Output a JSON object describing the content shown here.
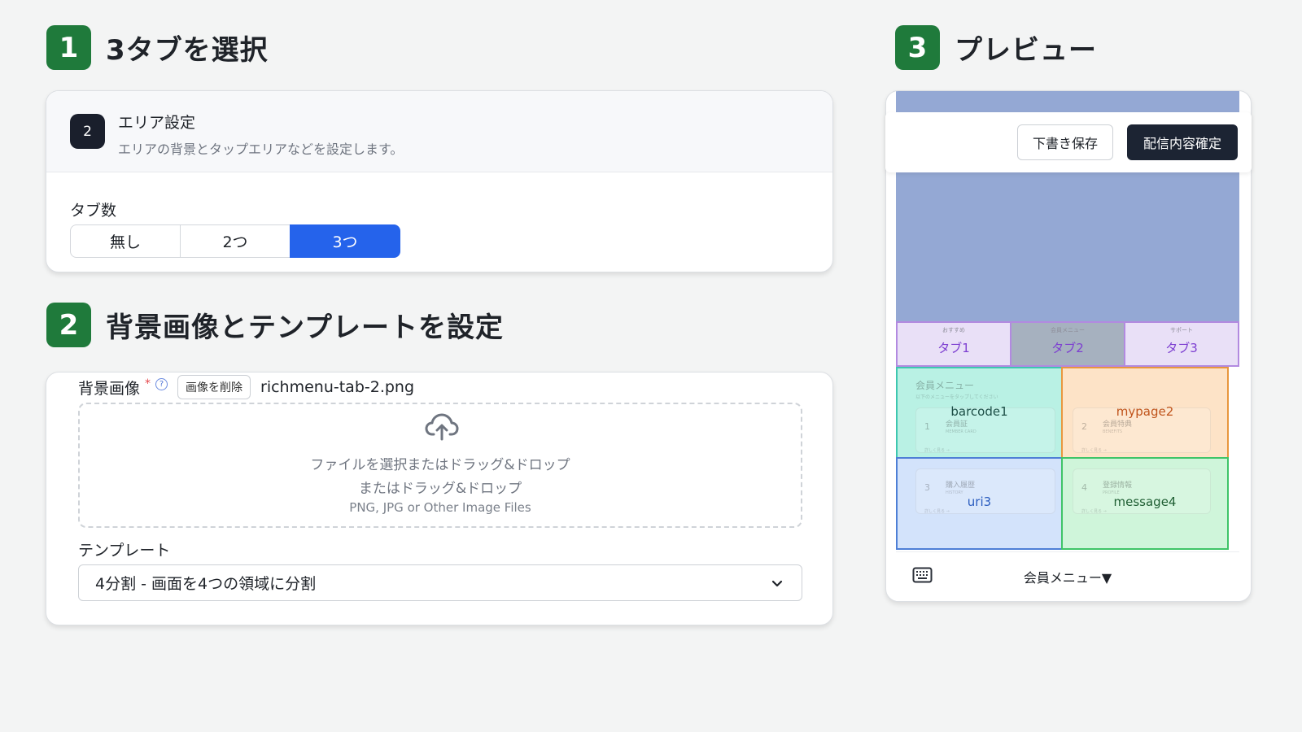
{
  "step1": {
    "number": "1",
    "title": "3タブを選択"
  },
  "step2": {
    "number": "2",
    "title": "背景画像とテンプレートを設定"
  },
  "step3": {
    "number": "3",
    "title": "プレビュー"
  },
  "area": {
    "badge": "2",
    "title": "エリア設定",
    "subtitle": "エリアの背景とタップエリアなどを設定します。",
    "tab_count_label": "タブ数",
    "options": [
      "無し",
      "2つ",
      "3つ"
    ],
    "selected": "3つ"
  },
  "background": {
    "label": "背景画像",
    "required_mark": "*",
    "help_icon": "?",
    "delete_button": "画像を削除",
    "file_name": "richmenu-tab-2.png",
    "drop_line1": "ファイルを選択またはドラッグ&ドロップ",
    "drop_line2": "またはドラッグ&ドロップ",
    "drop_line3": "PNG, JPG or Other Image Files"
  },
  "template": {
    "label": "テンプレート",
    "selected": "4分割 - 画面を4つの領域に分割"
  },
  "preview": {
    "draft_button": "下書き保存",
    "confirm_button": "配信内容確定",
    "tabs": [
      {
        "small": "おすすめ",
        "label": "タブ1"
      },
      {
        "small": "会員メニュー",
        "label": "タブ2"
      },
      {
        "small": "サポート",
        "label": "タブ3"
      }
    ],
    "ghost_title": "会員メニュー",
    "ghost_subtitle": "以下のメニューをタップしてください",
    "areas": [
      {
        "label": "barcode1",
        "num": "1",
        "ghost": "会員証",
        "ghost_sub": "MEMBER CARD",
        "ghost_link": "詳しく見る →"
      },
      {
        "label": "mypage2",
        "num": "2",
        "ghost": "会員特典",
        "ghost_sub": "BENEFITS",
        "ghost_link": "詳しく見る →"
      },
      {
        "label": "uri3",
        "num": "3",
        "ghost": "購入履歴",
        "ghost_sub": "HISTORY",
        "ghost_link": "詳しく見る →"
      },
      {
        "label": "message4",
        "num": "4",
        "ghost": "登録情報",
        "ghost_sub": "PROFILE",
        "ghost_link": "詳しく見る →"
      }
    ],
    "bar_label": "会員メニュー▼"
  },
  "colors": {
    "step_badge": "#1f7a3b",
    "selected_segment": "#2563eb",
    "preview_bg": "#94a8d4",
    "tab_border": "#b28ae0",
    "area1": "#b9f1e4",
    "area2": "#fde3c7",
    "area3": "#d3e3fb",
    "area4": "#cff5da"
  }
}
